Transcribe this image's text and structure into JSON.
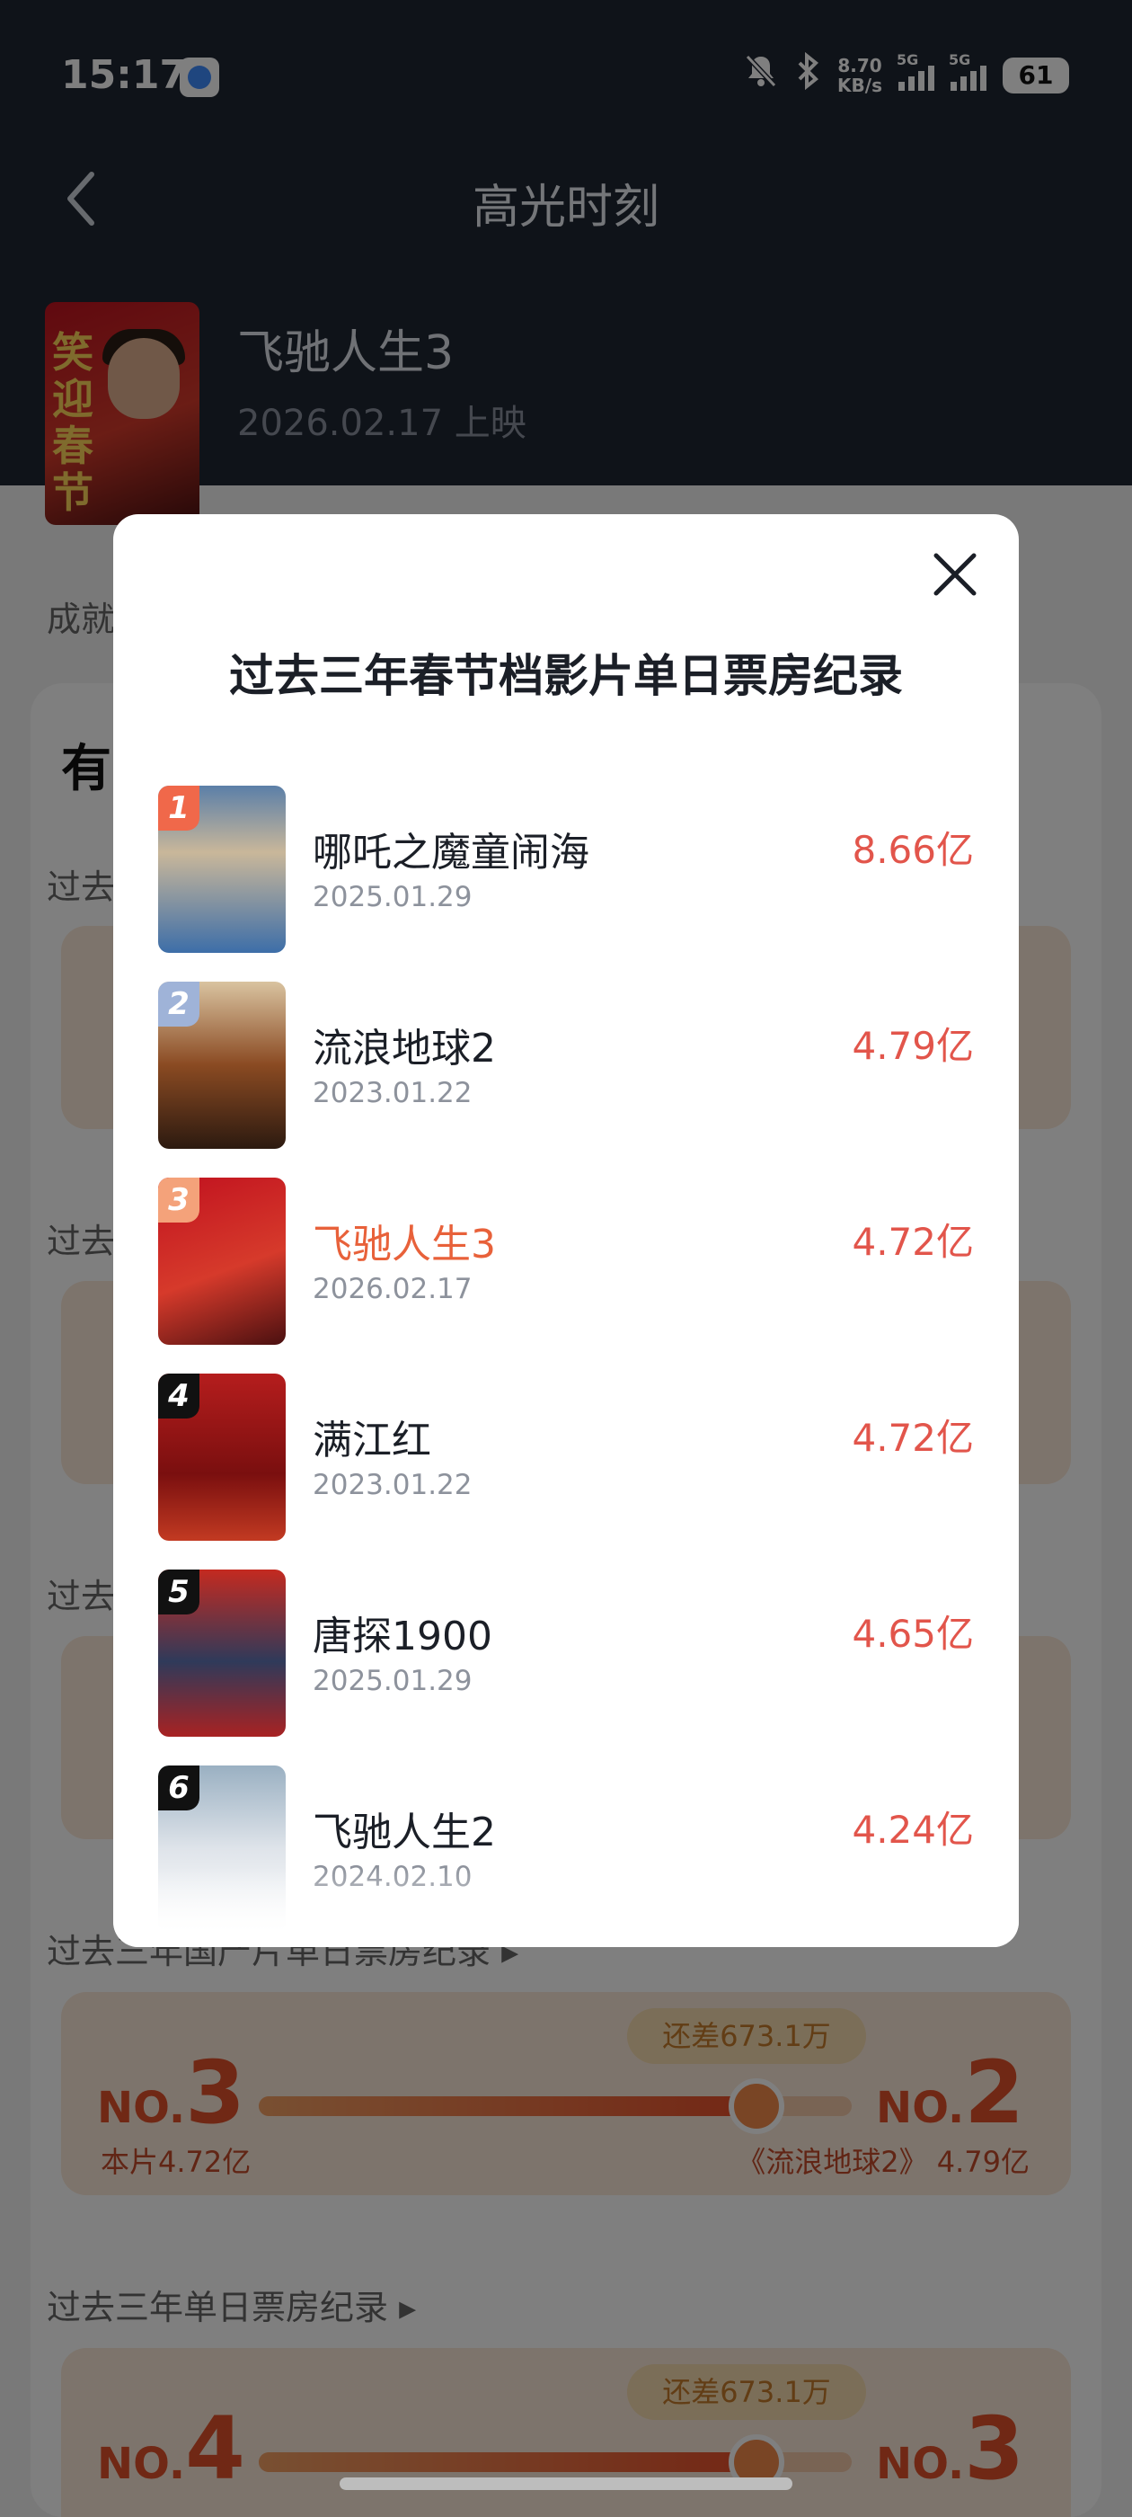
{
  "status_bar": {
    "time": "15:17",
    "net_speed_value": "8.70",
    "net_speed_unit": "KB/s",
    "signal1_label": "5G",
    "signal2_label": "5G",
    "battery": "61"
  },
  "header": {
    "title": "高光时刻"
  },
  "movie": {
    "name": "飞驰人生3",
    "release": "2026.02.17 上映"
  },
  "background": {
    "label_achievement": "成就",
    "big_title": "有",
    "label_past1": "过去",
    "label_past2": "过去",
    "label_past3": "过去",
    "section_domestic": "过去三年国产片单日票房纪录 ▸",
    "section_all": "过去三年单日票房纪录 ▸",
    "domestic_card": {
      "gap": "还差673.1万",
      "rank_prefix": "NO.",
      "this_rank": "3",
      "target_rank": "2",
      "this_label": "本片4.72亿",
      "target_label": "《流浪地球2》 4.79亿",
      "progress": 0.84
    },
    "all_card": {
      "gap": "还差673.1万",
      "rank_prefix": "NO.",
      "this_rank": "4",
      "target_rank": "3",
      "progress": 0.84
    }
  },
  "modal": {
    "title": "过去三年春节档影片单日票房纪录",
    "items": [
      {
        "rank": "1",
        "name": "哪吒之魔童闹海",
        "date": "2025.01.29",
        "value": "8.66亿"
      },
      {
        "rank": "2",
        "name": "流浪地球2",
        "date": "2023.01.22",
        "value": "4.79亿"
      },
      {
        "rank": "3",
        "name": "飞驰人生3",
        "date": "2026.02.17",
        "value": "4.72亿"
      },
      {
        "rank": "4",
        "name": "满江红",
        "date": "2023.01.22",
        "value": "4.72亿"
      },
      {
        "rank": "5",
        "name": "唐探1900",
        "date": "2025.01.29",
        "value": "4.65亿"
      },
      {
        "rank": "6",
        "name": "飞驰人生2",
        "date": "2024.02.10",
        "value": "4.24亿"
      }
    ]
  },
  "colors": {
    "header_bg": "#1f2633",
    "accent": "#e8613a",
    "value_red": "#e2554b",
    "badge_1": "#f0684a",
    "badge_2": "#9fb3d8",
    "badge_3": "#f4a27a",
    "badge_other": "#111111"
  }
}
